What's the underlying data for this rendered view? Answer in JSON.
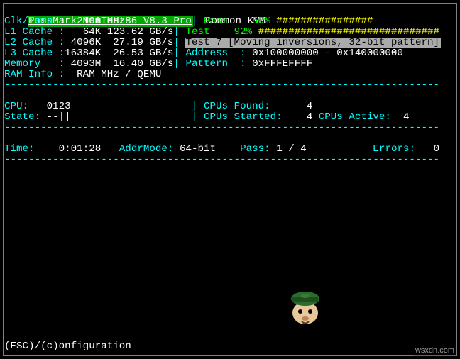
{
  "app": {
    "title": "PassMark MemTest86 V8.3 Pro",
    "system": "Common KVM"
  },
  "info": {
    "clk_label": "Clk/Temp :",
    "clk_value": "2100 MHz",
    "l1_label": "L1 Cache :",
    "l1_size": "64K",
    "l1_bw": "123.62 GB/s",
    "l2_label": "L2 Cache :",
    "l2_size": "4096K",
    "l2_bw": "27.19 GB/s",
    "l3_label": "L3 Cache :",
    "l3_size": "16384K",
    "l3_bw": "26.53 GB/s",
    "mem_label": "Memory   :",
    "mem_size": "4093M",
    "mem_bw": "16.40 GB/s",
    "ram_label": "RAM Info :",
    "ram_value": "RAM MHz / QEMU"
  },
  "progress": {
    "pass_label": "Pass",
    "pass_pct": "50%",
    "pass_bar": "################",
    "test_label": "Test",
    "test_pct": "92%",
    "test_bar": "##############################"
  },
  "current_test": {
    "line": "Test 7 [Moving inversions, 32-bit pattern]",
    "addr_l": "Address  :",
    "addr_v": "0x100000000 - 0x140000000",
    "patt_l": "Pattern  :",
    "patt_v": "0xFFFEFFFF"
  },
  "cpu": {
    "cpu_l": "CPU:",
    "cpu_v": "0123",
    "state_l": "State:",
    "state_v": "--||",
    "found_l": "CPUs Found:",
    "found_v": "4",
    "started_l": "CPUs Started:",
    "started_v": "4",
    "active_l": "CPUs Active:",
    "active_v": "4"
  },
  "status": {
    "time_l": "Time:",
    "time_v": "0:01:28",
    "addrm_l": "AddrMode:",
    "addrm_v": "64-bit",
    "pass_l": "Pass:",
    "pass_v": "1 / 4",
    "err_l": "Errors:",
    "err_v": "0"
  },
  "rule": "------------------------------------------------------------------------",
  "footer": "(ESC)/(c)onfiguration",
  "watermark": "wsxdn.com"
}
